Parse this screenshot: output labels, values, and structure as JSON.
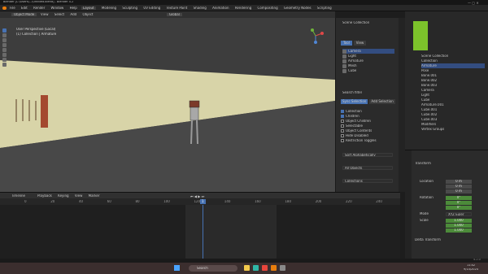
{
  "window": {
    "title": "Blender [C:\\Users\\...\\Untitled.blend] - Blender 4.2"
  },
  "menu": [
    "File",
    "Edit",
    "Render",
    "Window",
    "Help"
  ],
  "workspace_tabs": [
    "Layout",
    "Modeling",
    "Sculpting",
    "UV Editing",
    "Texture Paint",
    "Shading",
    "Animation",
    "Rendering",
    "Compositing",
    "Geometry Nodes",
    "Scripting"
  ],
  "viewport": {
    "mode": "Object Mode",
    "view_menu": [
      "View",
      "Select",
      "Add",
      "Object"
    ],
    "transform": "Global",
    "overlay_line1": "User Perspective (Local)",
    "overlay_line2": "(1) Collection | Armature"
  },
  "properties_panel": {
    "tabs": [
      "Tool",
      "View"
    ],
    "header": "Scene Collection",
    "items": [
      "Camera",
      "Light",
      "Armature",
      "Mesh",
      "Cube"
    ],
    "section": "Search filter",
    "buttons": [
      "Sync Selection",
      "Add Selection"
    ],
    "options": [
      "Collection",
      "Children",
      "Object Children",
      "Selectable",
      "Object Contents",
      "Hide Disabled",
      "Restriction Toggles"
    ],
    "dropdowns": [
      "Sort Alphabetically",
      "All Objects",
      "Collections"
    ]
  },
  "timeline": {
    "editor": "Timeline",
    "menus": [
      "Playback",
      "Keying",
      "View",
      "Marker"
    ],
    "current_frame": "1",
    "ticks": [
      "0",
      "20",
      "40",
      "60",
      "80",
      "100",
      "120",
      "140",
      "160",
      "180",
      "200",
      "220",
      "240"
    ]
  },
  "outliner": {
    "items": [
      "Scene Collection",
      "Collection",
      "Armature",
      "Pose",
      "Bone.001",
      "Bone.002",
      "Bone.003",
      "Camera",
      "Light",
      "Cube",
      "Armature.001",
      "Cube.001",
      "Cube.002",
      "Cube.003",
      "Modifiers",
      "Vertex Groups"
    ]
  },
  "transform_panel": {
    "header": "Transform",
    "location_label": "Location",
    "location": [
      "0 m",
      "0 m",
      "0 m"
    ],
    "rotation_label": "Rotation",
    "rotation": [
      "0°",
      "0°",
      "0°"
    ],
    "mode_label": "Mode",
    "mode": "XYZ Euler",
    "scale_label": "Scale",
    "scale": [
      "1.000",
      "1.000",
      "1.000"
    ],
    "delta": "Delta Transform"
  },
  "status_bar": {
    "version": "4.2.0"
  },
  "taskbar": {
    "search_placeholder": "Search",
    "time": "11:42",
    "date": "9/14/2024"
  },
  "colors": {
    "accent": "#4772b3",
    "active_green": "#7cc32b",
    "ground": "#d8d4a8"
  }
}
